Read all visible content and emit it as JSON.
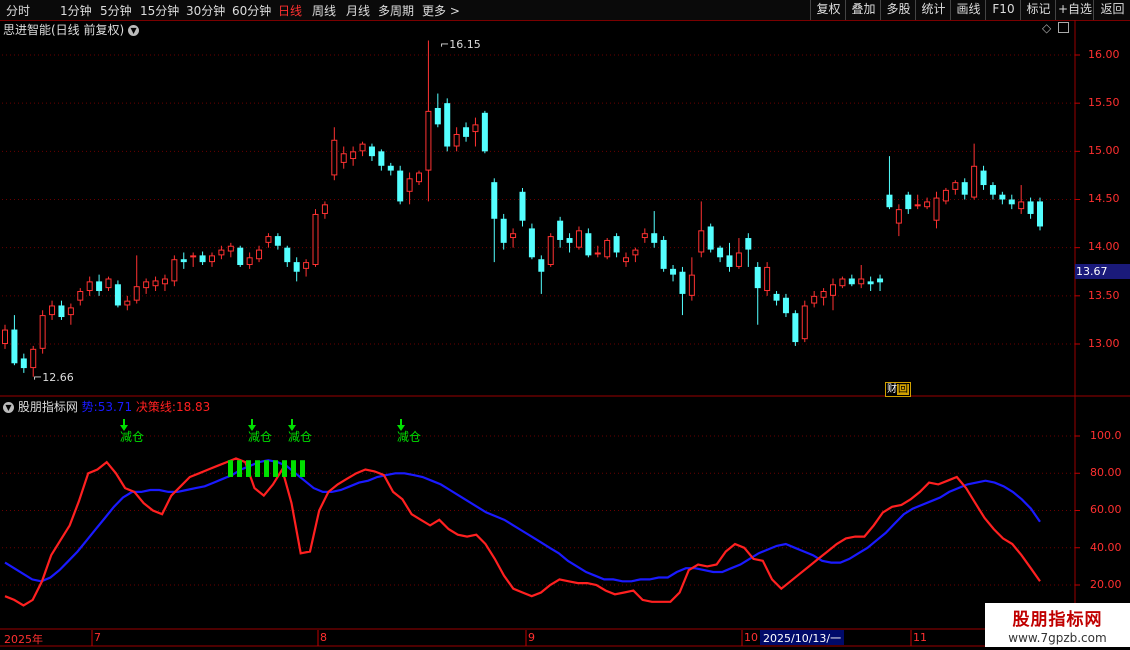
{
  "toolbar": {
    "periods": [
      "分时",
      "1分钟",
      "5分钟",
      "15分钟",
      "30分钟",
      "60分钟",
      "日线",
      "周线",
      "月线",
      "多周期",
      "更多 >"
    ],
    "active": "日线",
    "right": [
      "复权",
      "叠加",
      "多股",
      "统计",
      "画线",
      "F10",
      "标记",
      "+自选",
      "返回"
    ]
  },
  "main_chart": {
    "title": "思进智能(日线 前复权)",
    "y_ticks": [
      "16.00",
      "15.50",
      "15.00",
      "14.50",
      "14.00",
      "13.50",
      "13.00"
    ],
    "last_price": "13.67",
    "high_label": "16.15",
    "low_label": "12.66",
    "finance_badge": "财",
    "finance_badge_icon": "回"
  },
  "indicator": {
    "name": "股朋指标网",
    "line1_label": "势:",
    "line1_value": "53.71",
    "line2_label": "决策线:",
    "line2_value": "18.83",
    "signal_text": "减仓",
    "y_ticks": [
      "100.0",
      "80.00",
      "60.00",
      "40.00",
      "20.00"
    ]
  },
  "dates": {
    "year": "2025年",
    "months": [
      "7",
      "8",
      "9",
      "10",
      "11"
    ],
    "selected": "2025/10/13/一"
  },
  "watermark": {
    "title": "股朋指标网",
    "url": "www.7gpzb.com"
  },
  "colors": {
    "up": "#ff3232",
    "down": "#54ffff",
    "line_blue": "#1a1aff",
    "line_red": "#ff2020",
    "signal": "#00e000"
  },
  "chart_data": {
    "type": "candlestick",
    "price_range": [
      12.6,
      16.3
    ],
    "candles": [
      [
        13.0,
        13.15,
        12.95,
        13.2
      ],
      [
        13.15,
        12.8,
        12.78,
        13.3
      ],
      [
        12.85,
        12.75,
        12.7,
        12.9
      ],
      [
        12.75,
        12.95,
        12.66,
        12.98
      ],
      [
        12.95,
        13.3,
        12.9,
        13.35
      ],
      [
        13.3,
        13.4,
        13.25,
        13.45
      ],
      [
        13.4,
        13.28,
        13.25,
        13.45
      ],
      [
        13.3,
        13.38,
        13.2,
        13.42
      ],
      [
        13.45,
        13.55,
        13.4,
        13.58
      ],
      [
        13.55,
        13.65,
        13.5,
        13.7
      ],
      [
        13.65,
        13.55,
        13.5,
        13.72
      ],
      [
        13.58,
        13.68,
        13.55,
        13.7
      ],
      [
        13.62,
        13.4,
        13.38,
        13.66
      ],
      [
        13.4,
        13.45,
        13.35,
        13.5
      ],
      [
        13.45,
        13.6,
        13.42,
        13.92
      ],
      [
        13.58,
        13.65,
        13.52,
        13.68
      ],
      [
        13.6,
        13.66,
        13.55,
        13.7
      ],
      [
        13.62,
        13.68,
        13.55,
        13.72
      ],
      [
        13.65,
        13.88,
        13.6,
        13.92
      ],
      [
        13.88,
        13.85,
        13.78,
        13.95
      ],
      [
        13.9,
        13.92,
        13.8,
        13.95
      ],
      [
        13.92,
        13.85,
        13.82,
        13.96
      ],
      [
        13.85,
        13.92,
        13.8,
        13.95
      ],
      [
        13.92,
        13.98,
        13.88,
        14.02
      ],
      [
        13.96,
        14.02,
        13.9,
        14.05
      ],
      [
        14.0,
        13.82,
        13.8,
        14.02
      ],
      [
        13.82,
        13.9,
        13.78,
        13.95
      ],
      [
        13.88,
        13.98,
        13.85,
        14.02
      ],
      [
        14.05,
        14.12,
        14.0,
        14.15
      ],
      [
        14.12,
        14.02,
        13.98,
        14.15
      ],
      [
        14.0,
        13.85,
        13.8,
        14.02
      ],
      [
        13.85,
        13.75,
        13.65,
        13.9
      ],
      [
        13.78,
        13.85,
        13.7,
        13.88
      ],
      [
        13.82,
        14.35,
        13.8,
        14.4
      ],
      [
        14.35,
        14.45,
        14.3,
        14.48
      ],
      [
        14.75,
        15.12,
        14.7,
        15.25
      ],
      [
        14.88,
        14.98,
        14.82,
        15.05
      ],
      [
        14.92,
        15.0,
        14.85,
        15.05
      ],
      [
        15.0,
        15.08,
        14.95,
        15.1
      ],
      [
        15.05,
        14.95,
        14.9,
        15.08
      ],
      [
        15.0,
        14.85,
        14.8,
        15.02
      ],
      [
        14.85,
        14.8,
        14.75,
        14.88
      ],
      [
        14.8,
        14.48,
        14.45,
        14.85
      ],
      [
        14.58,
        14.72,
        14.45,
        14.78
      ],
      [
        14.68,
        14.78,
        14.65,
        14.8
      ],
      [
        14.8,
        15.42,
        14.48,
        16.15
      ],
      [
        15.45,
        15.28,
        15.25,
        15.6
      ],
      [
        15.5,
        15.05,
        15.0,
        15.55
      ],
      [
        15.05,
        15.18,
        15.0,
        15.25
      ],
      [
        15.25,
        15.15,
        15.1,
        15.3
      ],
      [
        15.2,
        15.28,
        15.05,
        15.35
      ],
      [
        15.4,
        15.0,
        14.98,
        15.42
      ],
      [
        14.68,
        14.3,
        13.85,
        14.72
      ],
      [
        14.3,
        14.05,
        13.98,
        14.35
      ],
      [
        14.1,
        14.15,
        14.0,
        14.2
      ],
      [
        14.58,
        14.28,
        14.22,
        14.62
      ],
      [
        14.2,
        13.9,
        13.88,
        14.25
      ],
      [
        13.88,
        13.75,
        13.52,
        13.92
      ],
      [
        13.82,
        14.12,
        13.8,
        14.15
      ],
      [
        14.28,
        14.08,
        14.0,
        14.32
      ],
      [
        14.1,
        14.05,
        13.95,
        14.15
      ],
      [
        14.0,
        14.18,
        13.98,
        14.22
      ],
      [
        14.15,
        13.92,
        13.9,
        14.2
      ],
      [
        13.95,
        13.95,
        13.9,
        14.02
      ],
      [
        13.9,
        14.08,
        13.88,
        14.1
      ],
      [
        14.12,
        13.95,
        13.9,
        14.15
      ],
      [
        13.85,
        13.9,
        13.8,
        13.95
      ],
      [
        13.92,
        13.98,
        13.85,
        14.0
      ],
      [
        14.1,
        14.15,
        14.05,
        14.2
      ],
      [
        14.15,
        14.05,
        14.0,
        14.38
      ],
      [
        14.08,
        13.78,
        13.75,
        14.12
      ],
      [
        13.78,
        13.72,
        13.65,
        13.82
      ],
      [
        13.75,
        13.52,
        13.3,
        13.8
      ],
      [
        13.5,
        13.72,
        13.45,
        13.9
      ],
      [
        13.95,
        14.18,
        13.9,
        14.48
      ],
      [
        14.22,
        13.98,
        13.95,
        14.25
      ],
      [
        14.0,
        13.9,
        13.85,
        14.02
      ],
      [
        13.92,
        13.8,
        13.75,
        14.05
      ],
      [
        13.8,
        13.95,
        13.78,
        14.1
      ],
      [
        14.1,
        13.98,
        13.8,
        14.15
      ],
      [
        13.8,
        13.58,
        13.2,
        13.85
      ],
      [
        13.55,
        13.8,
        13.5,
        13.85
      ],
      [
        13.52,
        13.45,
        13.4,
        13.55
      ],
      [
        13.48,
        13.32,
        13.28,
        13.52
      ],
      [
        13.32,
        13.02,
        12.98,
        13.35
      ],
      [
        13.05,
        13.4,
        13.02,
        13.45
      ],
      [
        13.42,
        13.5,
        13.38,
        13.55
      ],
      [
        13.48,
        13.55,
        13.4,
        13.58
      ],
      [
        13.5,
        13.62,
        13.35,
        13.68
      ],
      [
        13.6,
        13.68,
        13.58,
        13.7
      ],
      [
        13.68,
        13.62,
        13.6,
        13.72
      ],
      [
        13.62,
        13.68,
        13.58,
        13.82
      ],
      [
        13.65,
        13.62,
        13.55,
        13.7
      ],
      [
        13.68,
        13.64,
        13.55,
        13.72
      ],
      [
        14.55,
        14.42,
        14.4,
        14.95
      ],
      [
        14.25,
        14.4,
        14.12,
        14.45
      ],
      [
        14.55,
        14.4,
        14.35,
        14.58
      ],
      [
        14.45,
        14.45,
        14.4,
        14.55
      ],
      [
        14.42,
        14.48,
        14.4,
        14.52
      ],
      [
        14.28,
        14.52,
        14.2,
        14.58
      ],
      [
        14.48,
        14.6,
        14.45,
        14.62
      ],
      [
        14.6,
        14.68,
        14.55,
        14.7
      ],
      [
        14.68,
        14.55,
        14.5,
        14.72
      ],
      [
        14.52,
        14.85,
        14.5,
        15.08
      ],
      [
        14.8,
        14.65,
        14.6,
        14.85
      ],
      [
        14.65,
        14.55,
        14.5,
        14.68
      ],
      [
        14.55,
        14.5,
        14.45,
        14.58
      ],
      [
        14.5,
        14.45,
        14.4,
        14.55
      ],
      [
        14.4,
        14.48,
        14.35,
        14.65
      ],
      [
        14.48,
        14.35,
        14.3,
        14.52
      ],
      [
        14.48,
        14.22,
        14.18,
        14.52
      ]
    ],
    "indicator_range": [
      10,
      118
    ],
    "shi": [
      32,
      29,
      26,
      23,
      22,
      24,
      28,
      33,
      38,
      44,
      50,
      56,
      62,
      67,
      70,
      70,
      71,
      71,
      70,
      70,
      71,
      72,
      73,
      75,
      77,
      79,
      82,
      84,
      86,
      87,
      86,
      84,
      80,
      76,
      72,
      70,
      70,
      71,
      73,
      75,
      76,
      78,
      79,
      80,
      80,
      79,
      78,
      76,
      74,
      71,
      68,
      65,
      62,
      59,
      57,
      55,
      52,
      49,
      46,
      43,
      40,
      37,
      33,
      30,
      27,
      25,
      23,
      23,
      22,
      22,
      23,
      23,
      24,
      24,
      27,
      29,
      29,
      28,
      27,
      27,
      29,
      31,
      34,
      37,
      39,
      41,
      42,
      40,
      38,
      36,
      33,
      32,
      32,
      34,
      37,
      40,
      44,
      48,
      53,
      58,
      61,
      63,
      65,
      67,
      70,
      72,
      74,
      75,
      76,
      75,
      73,
      70,
      66,
      61,
      54
    ],
    "jcx": [
      14,
      12,
      9,
      12,
      22,
      36,
      44,
      52,
      65,
      80,
      82,
      86,
      80,
      72,
      70,
      64,
      60,
      58,
      68,
      73,
      78,
      80,
      82,
      84,
      86,
      88,
      86,
      72,
      68,
      74,
      82,
      64,
      37,
      38,
      60,
      70,
      74,
      77,
      80,
      82,
      81,
      79,
      70,
      66,
      58,
      55,
      52,
      55,
      50,
      47,
      46,
      47,
      42,
      34,
      25,
      18,
      16,
      14,
      16,
      20,
      23,
      22,
      21,
      21,
      20,
      17,
      15,
      16,
      17,
      12,
      11,
      11,
      11,
      16,
      28,
      31,
      30,
      31,
      38,
      42,
      40,
      34,
      33,
      23,
      18,
      22,
      26,
      30,
      34,
      38,
      42,
      45,
      46,
      46,
      52,
      59,
      62,
      63,
      66,
      70,
      75,
      74,
      76,
      78,
      72,
      64,
      56,
      50,
      45,
      42,
      36,
      29,
      22
    ]
  }
}
